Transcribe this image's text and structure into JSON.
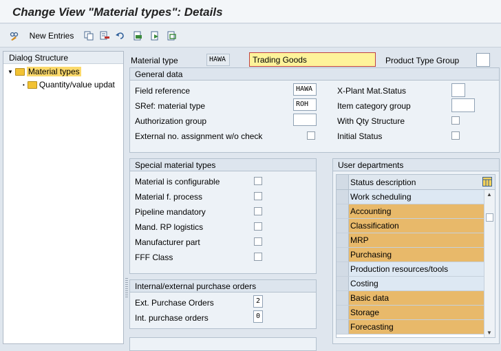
{
  "window": {
    "title": "Change View \"Material types\": Details"
  },
  "toolbar": {
    "new_entries": "New Entries"
  },
  "dialog_structure": {
    "header": "Dialog Structure",
    "items": [
      {
        "label": "Material types"
      },
      {
        "label": "Quantity/value updat"
      }
    ]
  },
  "header_fields": {
    "material_type_label": "Material type",
    "material_type_value": "HAWA",
    "material_type_desc": "Trading Goods",
    "product_type_group_label": "Product Type Group",
    "product_type_group_value": ""
  },
  "general_data": {
    "title": "General data",
    "field_reference_label": "Field reference",
    "field_reference_value": "HAWA",
    "sref_label": "SRef: material type",
    "sref_value": "ROH",
    "auth_group_label": "Authorization group",
    "auth_group_value": "",
    "ext_no_label": "External no. assignment w/o check",
    "xplant_label": "X-Plant Mat.Status",
    "xplant_value": "",
    "item_cat_label": "Item category group",
    "item_cat_value": "",
    "qty_structure_label": "With Qty Structure",
    "initial_status_label": "Initial Status"
  },
  "special_types": {
    "title": "Special material types",
    "items": [
      "Material is configurable",
      "Material f. process",
      "Pipeline mandatory",
      "Mand. RP logistics",
      "Manufacturer part",
      "FFF Class"
    ]
  },
  "purchase_orders": {
    "title": "Internal/external purchase orders",
    "ext_label": "Ext. Purchase Orders",
    "ext_value": "2",
    "int_label": "Int. purchase orders",
    "int_value": "0"
  },
  "user_departments": {
    "title": "User departments",
    "column": "Status description",
    "rows": [
      {
        "label": "Work scheduling",
        "selected": false
      },
      {
        "label": "Accounting",
        "selected": true
      },
      {
        "label": "Classification",
        "selected": true
      },
      {
        "label": "MRP",
        "selected": true
      },
      {
        "label": "Purchasing",
        "selected": true
      },
      {
        "label": "Production resources/tools",
        "selected": false
      },
      {
        "label": "Costing",
        "selected": false
      },
      {
        "label": "Basic data",
        "selected": true
      },
      {
        "label": "Storage",
        "selected": true
      },
      {
        "label": "Forecasting",
        "selected": true
      }
    ]
  },
  "colors": {
    "selected_row": "#e8b96a",
    "unselected_row": "#dde8f3",
    "highlight_field": "#fef39a",
    "tree_selection": "#fbd96b"
  }
}
